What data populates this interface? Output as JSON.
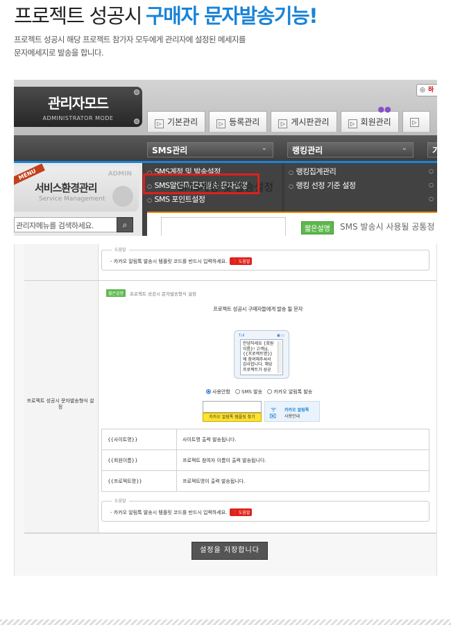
{
  "hero": {
    "title_part1": "프로젝트 성공시",
    "title_part2": "구매자 문자발송기능!",
    "desc_line1": "프로젝트 성공시 해당 프로젝트 참가자 모두에게 관리자에 설정된 메세지를",
    "desc_line2": "문자메세지로 발송을 합니다."
  },
  "admin": {
    "logo_ko": "관리자모드",
    "logo_en": "ADMINISTRATOR MODE",
    "login_btn": "하",
    "tabs": [
      {
        "label": "기본관리"
      },
      {
        "label": "등록관리"
      },
      {
        "label": "게시판관리"
      },
      {
        "label": "회원관리"
      },
      {
        "label": ""
      }
    ],
    "dropdowns": [
      {
        "label": "SMS관리"
      },
      {
        "label": "랭킹관리"
      },
      {
        "label": "기"
      }
    ],
    "sms_items": [
      "SMS계정 및 발송설정",
      "SMS알림톡/문자발송 문자설정",
      "SMS 포인트설정"
    ],
    "ranking_items": [
      "랭킹집계관리",
      "랭킹 선정 기준 설정"
    ],
    "ghost_text": "SMS계정 및 발송설정",
    "service_ribbon": "MENU",
    "service_admin": "ADMIN",
    "service_ko": "서비스환경관리",
    "service_en": "Service Management",
    "search_placeholder": "관리자메뉴를 검색하세요.",
    "quick_tag": "짧은설명",
    "quick_text": "SMS 발송시 사용될 공통정"
  },
  "form": {
    "help_legend": "도움말",
    "help_text": "- 카카오 알림톡 발송시 템플릿 코드를 반드시 입력하세요.",
    "help_btn": "도움말",
    "quick_tag": "짧은설명",
    "quick_text": "프로젝트 성공시 문자발송형식 설정",
    "sample_caption": "프로젝트 성공시 구매자들에게 발송 될 문자",
    "phone_status": "T.ıll",
    "phone_message": "안녕하세요 {회원이름}! 고객님, {{프로젝트명}}에 참여해주셔서 감사합니다. 해당 프로젝트가 성공",
    "radio_options": [
      "사용안함",
      "SMS 발송",
      "카카오 알림톡 발송"
    ],
    "find_btn": "카카오 알림톡 템플릿 찾기",
    "kakao_line1": "카카오 알림톡",
    "kakao_line2": "사용안내",
    "row_label": "프로젝트 성공시 문자발송형식 설정",
    "variables": [
      {
        "key": "{{사이트명}}",
        "desc": "사이트명 출력 발송됩니다."
      },
      {
        "key": "{{회원이름}}",
        "desc": "프로젝트 참여자 이름이 출력 발송됩니다."
      },
      {
        "key": "{{프로젝트명}}",
        "desc": "프로젝트명이 출력 발송됩니다."
      }
    ],
    "save_btn": "설정을 저장합니다"
  }
}
